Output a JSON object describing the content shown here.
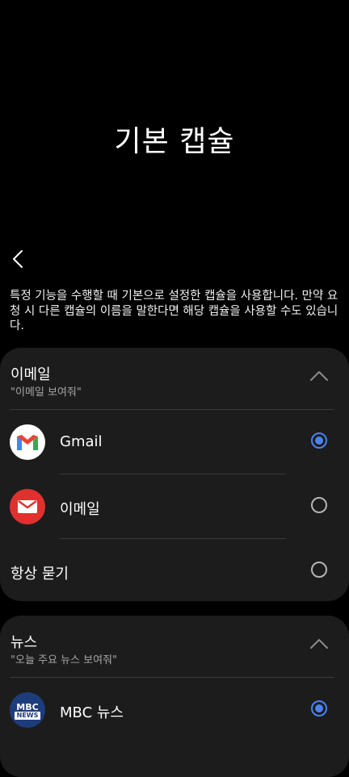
{
  "header": {
    "title": "기본 캡슐"
  },
  "description": "특정 기능을 수행할 때 기본으로 설정한 캡슐을 사용합니다. 만약 요청 시 다른 캡슐의 이름을 말한다면 해당 캡슐을 사용할 수도 있습니다.",
  "sections": [
    {
      "title": "이메일",
      "example": "\"이메일 보여줘\"",
      "options": [
        {
          "label": "Gmail",
          "icon": "gmail-icon",
          "selected": true
        },
        {
          "label": "이메일",
          "icon": "email-app-icon",
          "selected": false
        },
        {
          "label": "항상 묻기",
          "selected": false
        }
      ]
    },
    {
      "title": "뉴스",
      "example": "\"오늘 주요 뉴스 보여줘\"",
      "options": [
        {
          "label": "MBC 뉴스",
          "icon": "mbc-news-icon",
          "icon_text_top": "MBC",
          "icon_text_bottom": "NEWS",
          "selected": true
        }
      ]
    }
  ],
  "colors": {
    "accent": "#4a82f0",
    "card": "#1c1c1c",
    "background": "#000000",
    "email_red": "#e0312f",
    "mbc_navy": "#1d3c7c"
  }
}
